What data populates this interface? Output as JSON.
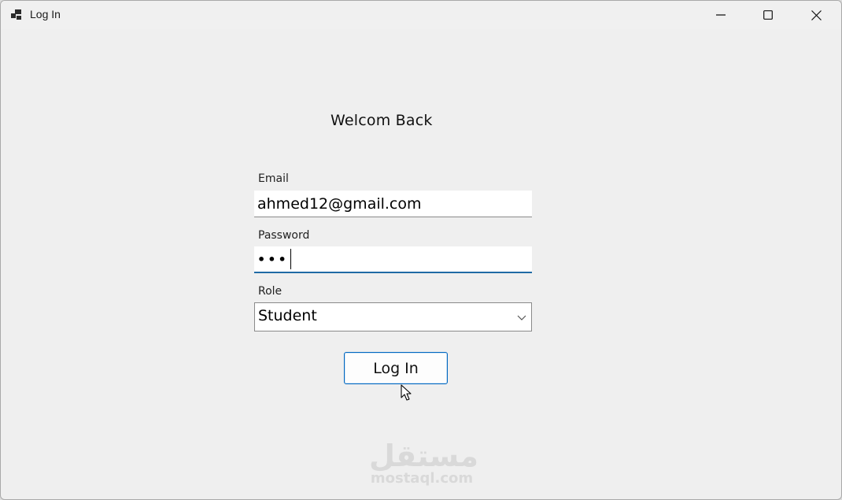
{
  "window": {
    "title": "Log In",
    "icon": "app-window-icon",
    "controls": [
      "minimize-icon",
      "maximize-icon",
      "close-icon"
    ]
  },
  "form": {
    "heading": "Welcom Back",
    "email": {
      "label": "Email",
      "value": "ahmed12@gmail.com"
    },
    "password": {
      "label": "Password",
      "masked_value": "•••"
    },
    "role": {
      "label": "Role",
      "selected": "Student"
    },
    "submit_label": "Log In"
  },
  "watermark": {
    "logo_text": "مستقل",
    "url": "mostaql.com"
  },
  "colors": {
    "focus_accent": "#1f6aa5",
    "button_border": "#0067c0",
    "window_bg": "#efefef"
  }
}
